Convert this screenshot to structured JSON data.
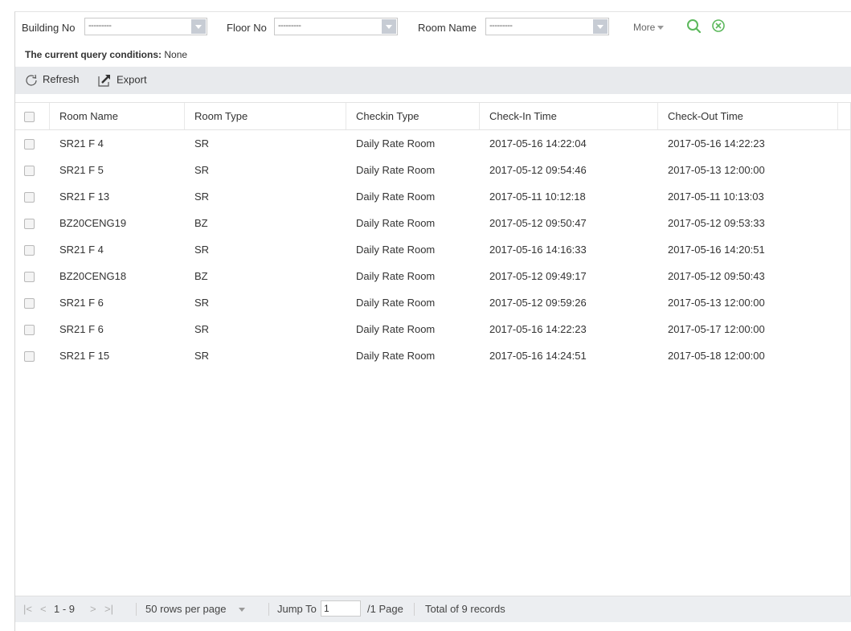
{
  "filters": {
    "building_label": "Building No",
    "building_value": "---------",
    "floor_label": "Floor No",
    "floor_value": "---------",
    "room_label": "Room Name",
    "room_value": "---------",
    "more_label": "More"
  },
  "query": {
    "label": "The current query conditions:",
    "value": "None"
  },
  "toolbar": {
    "refresh_label": "Refresh",
    "export_label": "Export"
  },
  "table": {
    "columns": [
      "Room Name",
      "Room Type",
      "Checkin Type",
      "Check-In Time",
      "Check-Out Time"
    ],
    "rows": [
      [
        "SR21 F 4",
        "SR",
        "Daily Rate Room",
        "2017-05-16 14:22:04",
        "2017-05-16 14:22:23"
      ],
      [
        "SR21 F 5",
        "SR",
        "Daily Rate Room",
        "2017-05-12 09:54:46",
        "2017-05-13 12:00:00"
      ],
      [
        "SR21 F 13",
        "SR",
        "Daily Rate Room",
        "2017-05-11 10:12:18",
        "2017-05-11 10:13:03"
      ],
      [
        "BZ20CENG19",
        "BZ",
        "Daily Rate Room",
        "2017-05-12 09:50:47",
        "2017-05-12 09:53:33"
      ],
      [
        "SR21 F 4",
        "SR",
        "Daily Rate Room",
        "2017-05-16 14:16:33",
        "2017-05-16 14:20:51"
      ],
      [
        "BZ20CENG18",
        "BZ",
        "Daily Rate Room",
        "2017-05-12 09:49:17",
        "2017-05-12 09:50:43"
      ],
      [
        "SR21 F 6",
        "SR",
        "Daily Rate Room",
        "2017-05-12 09:59:26",
        "2017-05-13 12:00:00"
      ],
      [
        "SR21 F 6",
        "SR",
        "Daily Rate Room",
        "2017-05-16 14:22:23",
        "2017-05-17 12:00:00"
      ],
      [
        "SR21 F 15",
        "SR",
        "Daily Rate Room",
        "2017-05-16 14:24:51",
        "2017-05-18 12:00:00"
      ]
    ]
  },
  "pager": {
    "first": "|<",
    "prev": "<",
    "range": "1 - 9",
    "next": ">",
    "last": ">|",
    "rows_per_page": "50 rows per page",
    "jump_label": "Jump To",
    "jump_value": "1",
    "page_total": "/1 Page",
    "records": "Total of 9 records"
  },
  "colors": {
    "accent_green": "#5cb85c",
    "toolbar_bg": "#e8eaed"
  }
}
